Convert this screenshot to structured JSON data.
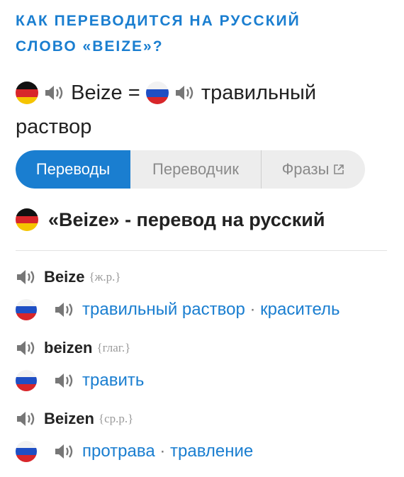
{
  "heading": {
    "line1": "КАК ПЕРЕВОДИТСЯ НА РУССКИЙ",
    "line2": "СЛОВО «BEIZE»?"
  },
  "hero": {
    "word": "Beize",
    "equals": "=",
    "translation_l1": "травильный",
    "translation_l2": "раствор"
  },
  "tabs": [
    {
      "label": "Переводы",
      "active": true
    },
    {
      "label": "Переводчик",
      "active": false
    },
    {
      "label": "Фразы",
      "active": false
    }
  ],
  "section_title": "«Beize» - перевод на русский",
  "entries": [
    {
      "word": "Beize",
      "gram": "{ж.р.}",
      "translations": [
        "травильный раствор",
        "краситель"
      ]
    },
    {
      "word": "beizen",
      "gram": "{глаг.}",
      "translations": [
        "травить"
      ]
    },
    {
      "word": "Beizen",
      "gram": "{ср.р.}",
      "translations": [
        "протрава",
        "травление"
      ]
    }
  ],
  "separator": "·",
  "colors": {
    "accent": "#1a7ed0",
    "tab_bg": "#ededed"
  },
  "icons": [
    "german-flag-icon",
    "russian-flag-icon",
    "speaker-icon",
    "external-link-icon"
  ]
}
